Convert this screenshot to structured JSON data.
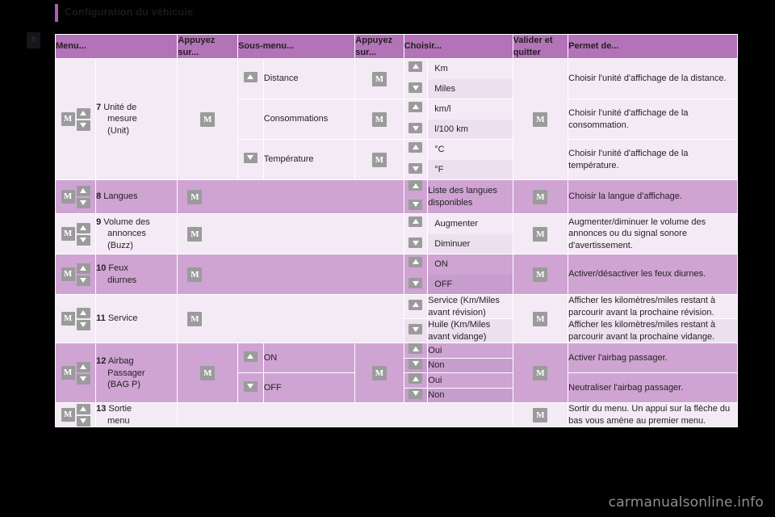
{
  "header": {
    "title": "Configuration du véhicule",
    "accent_color": "#b05cb0",
    "page_marker": "8"
  },
  "watermark": "carmanualsonline.info",
  "icons": {
    "m_button": "M",
    "arrow_up": "up-arrow",
    "arrow_down": "down-arrow"
  },
  "table": {
    "columns": [
      "Menu...",
      "Appuyez sur...",
      "Sous-menu...",
      "Appuyez sur...",
      "Choisir...",
      "Valider et quitter",
      "Permet de..."
    ],
    "rows": [
      {
        "num": "7",
        "menu": "Unité de mesure (Unit)",
        "menu_line1": "Unité de",
        "menu_line2": "mesure",
        "menu_line3": "(Unit)",
        "submenus": [
          {
            "arrow": "up",
            "label": "Distance",
            "choices": [
              "Km",
              "Miles"
            ],
            "desc": "Choisir l'unité d'affichage de la distance."
          },
          {
            "arrow": "none",
            "label": "Consommations",
            "choices": [
              "km/l",
              "l/100 km"
            ],
            "desc": "Choisir l'unité d'affichage de la consommation."
          },
          {
            "arrow": "down",
            "label": "Température",
            "choices": [
              "°C",
              "°F"
            ],
            "desc": "Choisir l'unité d'affichage de la température."
          }
        ]
      },
      {
        "num": "8",
        "menu": "Langues",
        "choice": "Liste des langues disponibles",
        "desc": "Choisir la langue d'affichage."
      },
      {
        "num": "9",
        "menu": "Volume des annonces (Buzz)",
        "menu_line1": "Volume des",
        "menu_line2": "annonces",
        "menu_line3": "(Buzz)",
        "choices": [
          "Augmenter",
          "Diminuer"
        ],
        "desc": "Augmenter/diminuer le volume des annonces ou du signal sonore d'avertissement."
      },
      {
        "num": "10",
        "menu": "Feux diurnes",
        "menu_line1": "Feux",
        "menu_line2": "diurnes",
        "choices": [
          "ON",
          "OFF"
        ],
        "desc": "Activer/désactiver les feux diurnes."
      },
      {
        "num": "11",
        "menu": "Service",
        "choices": [
          "Service (Km/Miles avant révision)",
          "Huile (Km/Miles avant vidange)"
        ],
        "descs": [
          "Afficher les kilomètres/miles restant à parcourir avant la prochaine révision.",
          "Afficher les kilomètres/miles restant à parcourir avant la prochaine vidange."
        ]
      },
      {
        "num": "12",
        "menu": "Airbag Passager (BAG P)",
        "menu_line1": "Airbag",
        "menu_line2": "Passager",
        "menu_line3": "(BAG P)",
        "submenus": [
          {
            "arrow": "up",
            "label": "ON",
            "choices": [
              "Oui",
              "Non"
            ],
            "desc": "Activer l'airbag passager."
          },
          {
            "arrow": "down",
            "label": "OFF",
            "choices": [
              "Oui",
              "Non"
            ],
            "desc": "Neutraliser l'airbag passager."
          }
        ]
      },
      {
        "num": "13",
        "menu": "Sortie menu",
        "menu_line1": "Sortie",
        "menu_line2": "menu",
        "desc": "Sortir du menu. Un appui sur la flèche du bas vous amène au premier menu."
      }
    ]
  }
}
